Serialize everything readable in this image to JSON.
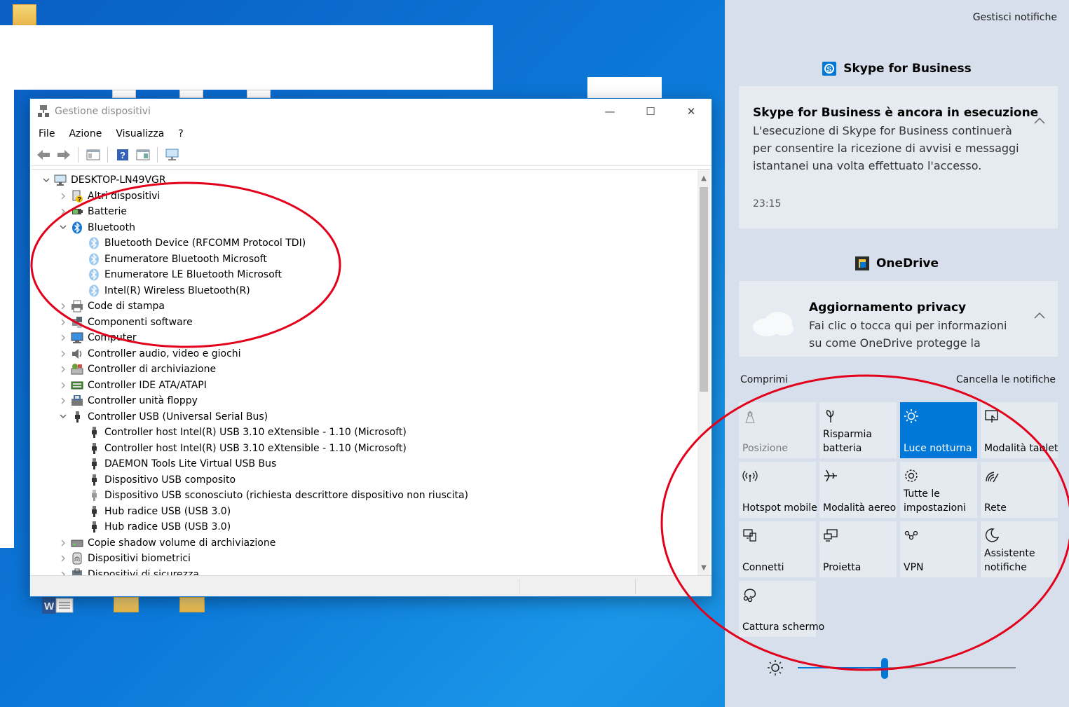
{
  "device_manager": {
    "title": "Gestione dispositivi",
    "window_controls": {
      "minimize": "—",
      "maximize": "☐",
      "close": "✕"
    },
    "menu": [
      "File",
      "Azione",
      "Visualizza",
      "?"
    ],
    "tree": [
      {
        "level": 0,
        "exp": "v",
        "icon": "computer",
        "label": "DESKTOP-LN49VGR"
      },
      {
        "level": 1,
        "exp": ">",
        "icon": "unknown",
        "label": "Altri dispositivi"
      },
      {
        "level": 1,
        "exp": ">",
        "icon": "battery",
        "label": "Batterie"
      },
      {
        "level": 1,
        "exp": "v",
        "icon": "bluetooth",
        "label": "Bluetooth"
      },
      {
        "level": 2,
        "exp": "",
        "icon": "bluetooth-light",
        "label": "Bluetooth Device (RFCOMM Protocol TDI)"
      },
      {
        "level": 2,
        "exp": "",
        "icon": "bluetooth-light",
        "label": "Enumeratore Bluetooth Microsoft"
      },
      {
        "level": 2,
        "exp": "",
        "icon": "bluetooth-light",
        "label": "Enumeratore LE Bluetooth Microsoft"
      },
      {
        "level": 2,
        "exp": "",
        "icon": "bluetooth-light",
        "label": "Intel(R) Wireless Bluetooth(R)"
      },
      {
        "level": 1,
        "exp": ">",
        "icon": "printer",
        "label": "Code di stampa"
      },
      {
        "level": 1,
        "exp": ">",
        "icon": "component",
        "label": "Componenti software"
      },
      {
        "level": 1,
        "exp": ">",
        "icon": "monitor",
        "label": "Computer"
      },
      {
        "level": 1,
        "exp": ">",
        "icon": "speaker",
        "label": "Controller audio, video e giochi"
      },
      {
        "level": 1,
        "exp": ">",
        "icon": "storage",
        "label": "Controller di archiviazione"
      },
      {
        "level": 1,
        "exp": ">",
        "icon": "ide",
        "label": "Controller IDE ATA/ATAPI"
      },
      {
        "level": 1,
        "exp": ">",
        "icon": "floppy",
        "label": "Controller unità floppy"
      },
      {
        "level": 1,
        "exp": "v",
        "icon": "usb",
        "label": "Controller USB (Universal Serial Bus)"
      },
      {
        "level": 2,
        "exp": "",
        "icon": "usb",
        "label": "Controller host Intel(R) USB 3.10 eXtensible - 1.10 (Microsoft)"
      },
      {
        "level": 2,
        "exp": "",
        "icon": "usb",
        "label": "Controller host Intel(R) USB 3.10 eXtensible - 1.10 (Microsoft)"
      },
      {
        "level": 2,
        "exp": "",
        "icon": "usb",
        "label": "DAEMON Tools Lite Virtual USB Bus"
      },
      {
        "level": 2,
        "exp": "",
        "icon": "usb",
        "label": "Dispositivo USB composito"
      },
      {
        "level": 2,
        "exp": "",
        "icon": "usb-warn",
        "label": "Dispositivo USB sconosciuto (richiesta descrittore dispositivo non riuscita)"
      },
      {
        "level": 2,
        "exp": "",
        "icon": "usb",
        "label": "Hub radice USB (USB 3.0)"
      },
      {
        "level": 2,
        "exp": "",
        "icon": "usb",
        "label": "Hub radice USB (USB 3.0)"
      },
      {
        "level": 1,
        "exp": ">",
        "icon": "drive",
        "label": "Copie shadow volume di archiviazione"
      },
      {
        "level": 1,
        "exp": ">",
        "icon": "fingerprint",
        "label": "Dispositivi biometrici"
      },
      {
        "level": 1,
        "exp": ">",
        "icon": "security",
        "label": "Dispositivi di sicurezza"
      }
    ]
  },
  "action_center": {
    "manage_link": "Gestisci notifiche",
    "groups": [
      {
        "app": "Skype for Business",
        "title": "Skype for Business è ancora in esecuzione",
        "body_lines": [
          "L'esecuzione di Skype for Business continuerà",
          "per consentire la ricezione di avvisi e messaggi",
          "istantanei una volta effettuato l'accesso."
        ],
        "time": "23:15"
      },
      {
        "app": "OneDrive",
        "title": "Aggiornamento privacy",
        "body_lines": [
          "Fai clic o tocca qui per informazioni",
          "su come OneDrive protegge la"
        ]
      }
    ],
    "collapse_link": "Comprimi",
    "clear_link": "Cancella le notifiche",
    "quick_actions": [
      {
        "label": "Posizione",
        "icon": "location-icon",
        "state": "disabled"
      },
      {
        "label": "Risparmia batteria",
        "icon": "battery-saver-icon",
        "state": "off"
      },
      {
        "label": "Luce notturna",
        "icon": "night-light-icon",
        "state": "on"
      },
      {
        "label": "Modalità tablet",
        "icon": "tablet-mode-icon",
        "state": "off"
      },
      {
        "label": "Hotspot mobile",
        "icon": "hotspot-icon",
        "state": "off"
      },
      {
        "label": "Modalità aereo",
        "icon": "airplane-icon",
        "state": "off"
      },
      {
        "label": "Tutte le impostazioni",
        "icon": "settings-icon",
        "state": "off"
      },
      {
        "label": "Rete",
        "icon": "network-icon",
        "state": "off"
      },
      {
        "label": "Connetti",
        "icon": "connect-icon",
        "state": "off"
      },
      {
        "label": "Proietta",
        "icon": "project-icon",
        "state": "off"
      },
      {
        "label": "VPN",
        "icon": "vpn-icon",
        "state": "off"
      },
      {
        "label": "Assistente notifiche",
        "icon": "focus-assist-icon",
        "state": "off"
      },
      {
        "label": "Cattura schermo",
        "icon": "snip-icon",
        "state": "off"
      }
    ],
    "brightness_fraction": 0.4
  },
  "colors": {
    "accent": "#0078d7",
    "annotation": "#e3001b",
    "action_center_bg": "#d6dfeb"
  }
}
